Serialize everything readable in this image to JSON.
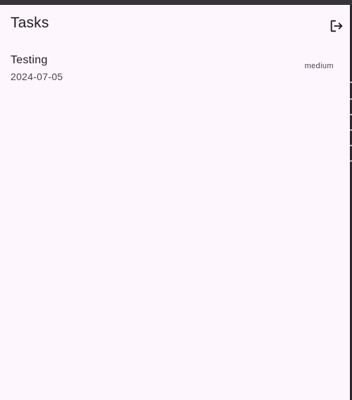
{
  "app": {
    "title": "Tasks"
  },
  "icons": {
    "logout": "logout-icon"
  },
  "colors": {
    "background": "#fdf6fc",
    "text_primary": "#1d1b20",
    "text_secondary": "#49454f",
    "frame": "#37353a"
  },
  "tasks": [
    {
      "title": "Testing",
      "date": "2024-07-05",
      "priority": "medium"
    }
  ]
}
